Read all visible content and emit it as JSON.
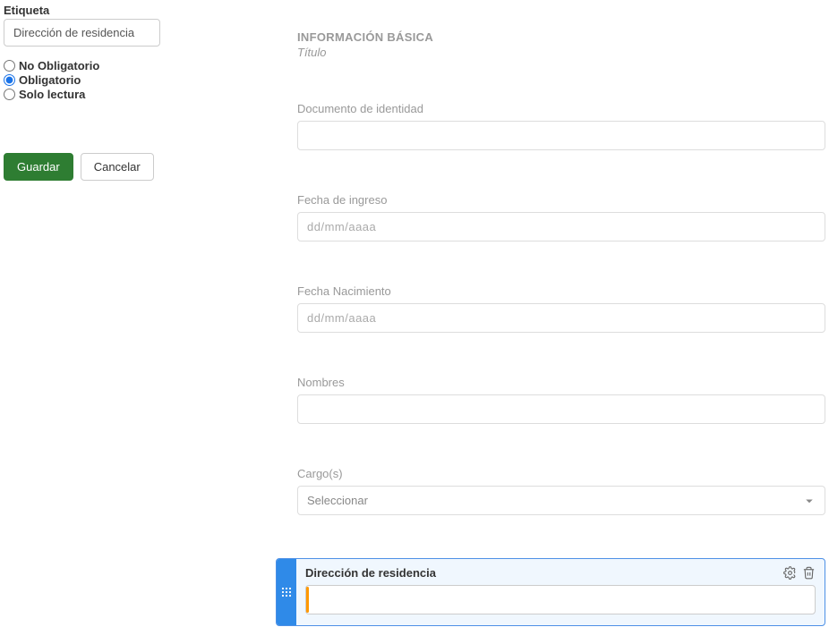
{
  "left": {
    "etiqueta_label": "Etiqueta",
    "etiqueta_value": "Dirección de residencia",
    "radios": {
      "no_obligatorio": "No Obligatorio",
      "obligatorio": "Obligatorio",
      "solo_lectura": "Solo lectura"
    },
    "buttons": {
      "guardar": "Guardar",
      "cancelar": "Cancelar"
    }
  },
  "form": {
    "section_title": "INFORMACIÓN BÁSICA",
    "section_subtitle": "Título",
    "fields": {
      "documento_identidad": {
        "label": "Documento de identidad"
      },
      "fecha_ingreso": {
        "label": "Fecha de ingreso",
        "placeholder": "dd/mm/aaaa"
      },
      "fecha_nacimiento": {
        "label": "Fecha Nacimiento",
        "placeholder": "dd/mm/aaaa"
      },
      "nombres": {
        "label": "Nombres"
      },
      "cargos": {
        "label": "Cargo(s)",
        "placeholder": "Seleccionar"
      },
      "direccion_residencia": {
        "label": "Dirección de residencia"
      }
    }
  }
}
